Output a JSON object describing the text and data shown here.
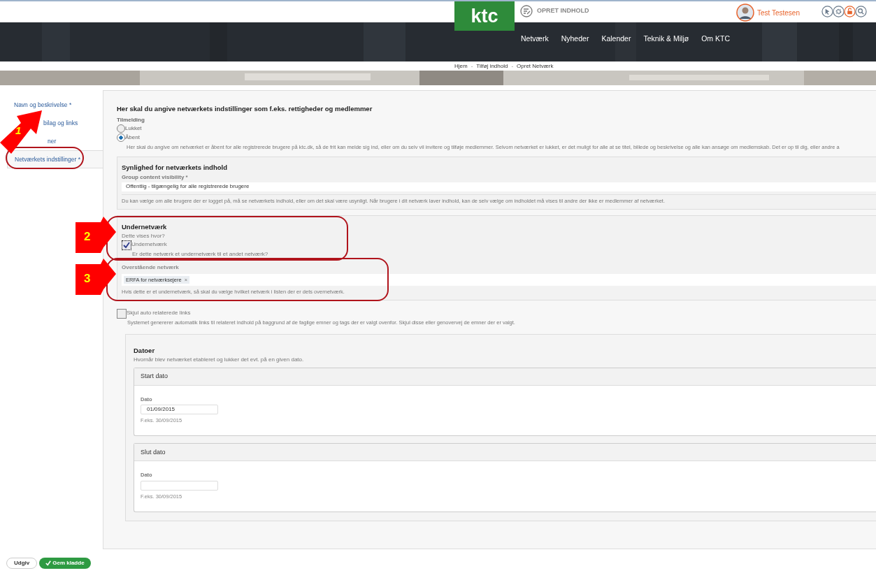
{
  "header": {
    "logo": "ktc",
    "create_content": "OPRET INDHOLD",
    "user": "Test Testesen",
    "nav": [
      "Netværk",
      "Nyheder",
      "Kalender",
      "Teknik & Miljø",
      "Om KTC"
    ],
    "breadcrumb": [
      "Hjem",
      "-",
      "Tilføj indhold",
      "-",
      "Opret Netværk"
    ]
  },
  "sidebar": {
    "tabs": [
      {
        "label": "Navn og beskrivelse *",
        "selected": false
      },
      {
        "label": "bilag og links",
        "selected": false
      },
      {
        "label": "ner",
        "selected": false
      },
      {
        "label": "Netværkets indstillinger *",
        "selected": true
      }
    ]
  },
  "form": {
    "intro": "Her skal du angive netværkets indstillinger som f.eks. rettigheder og medlemmer",
    "tilmelding": {
      "label": "Tilmelding",
      "options": [
        {
          "label": "Lukket",
          "selected": false
        },
        {
          "label": "Åbent",
          "selected": true
        }
      ],
      "help": "Her skal du angive om netværket er åbent for alle registrerede brugere på ktc.dk, så de frit kan melde sig ind, eller om du selv vil invitere og tilføje medlemmer. Selvom netværket er lukket, er det muligt for alle at se titel, billede og beskrivelse og alle kan ansøge om medlemskab. Det er op til dig, eller andre a"
    },
    "visibility": {
      "title": "Synlighed for netværkets indhold",
      "label": "Group content visibility *",
      "value": "Offentlig - tilgængelig for alle registrerede brugere",
      "help": "Du kan vælge om alle brugere der er logget på, må se netværkets indhold, eller om det skal være usynligt. Når brugere i dit netværk laver indhold, kan de selv vælge om indholdet må vises til andre der ikke er medlemmer af netværket."
    },
    "subnetwork": {
      "title": "Undernetværk",
      "description": "Dette vises hvor?",
      "checkbox": {
        "label": "Undernetværk",
        "checked": true
      },
      "help": "Er dette netværk et undernetværk til et andet netværk?"
    },
    "parent_network": {
      "label": "Overstående netværk",
      "tags": [
        {
          "label": "ERFA for netværksejere",
          "remove": "×"
        }
      ],
      "help": "Hvis dette er et undernetværk, så skal du vælge hvilket netværk i listen der er dets overnetværk."
    },
    "hide_links": {
      "label": "Skjul auto relaterede links",
      "checked": false,
      "help": "Systemet genererer automatik links til relateret indhold på baggrund af de faglige emner og tags der er valgt ovenfor. Skjul disse eller genovervej de emner der er valgt."
    },
    "dates": {
      "title": "Datoer",
      "description": "Hvornår blev netværket etableret og lukker det evt. på en given dato.",
      "panels": [
        {
          "title": "Start dato",
          "field_label": "Dato",
          "value": "01/09/2015",
          "hint": "F.eks. 30/09/2015"
        },
        {
          "title": "Slut dato",
          "field_label": "Dato",
          "hint": "F.eks. 30/09/2015"
        }
      ]
    }
  },
  "buttons": [
    {
      "label": "Udgiv",
      "kind": "plain"
    },
    {
      "label": "Gem kladde",
      "kind": "primary"
    }
  ],
  "annotations": [
    {
      "number": "1"
    },
    {
      "number": "2"
    },
    {
      "number": "3"
    }
  ]
}
